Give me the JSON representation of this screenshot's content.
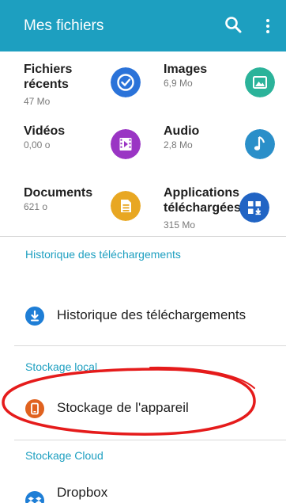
{
  "app_bar": {
    "title": "Mes fichiers",
    "icons": [
      "search-icon",
      "more-vert-icon"
    ],
    "color": "#1d9fc0"
  },
  "categories": [
    {
      "label": "Fichiers récents",
      "size": "47 Mo",
      "icon": "clock-check-icon",
      "color": "#2b73d9"
    },
    {
      "label": "Images",
      "size": "6,9 Mo",
      "icon": "image-icon",
      "color": "#2bb39a"
    },
    {
      "label": "Vidéos",
      "size": "0,00 o",
      "icon": "film-icon",
      "color": "#9a35c4"
    },
    {
      "label": "Audio",
      "size": "2,8 Mo",
      "icon": "music-note-icon",
      "color": "#2a8fc9"
    },
    {
      "label": "Documents",
      "size": "621 o",
      "icon": "document-icon",
      "color": "#e8a722"
    },
    {
      "label": "Applications téléchargées",
      "size": "315 Mo",
      "icon": "app-download-icon",
      "color": "#2164c4"
    }
  ],
  "sections": {
    "downloads": {
      "header": "Historique des téléchargements",
      "item": {
        "label": "Historique des téléchargements",
        "icon": "download-circle-icon",
        "color": "#1e7ed6"
      }
    },
    "local": {
      "header": "Stockage local",
      "item": {
        "label": "Stockage de l'appareil",
        "icon": "device-storage-icon",
        "color": "#e0621f"
      }
    },
    "cloud": {
      "header": "Stockage Cloud",
      "item": {
        "label": "Dropbox",
        "icon": "dropbox-icon",
        "color": "#1e7ed6"
      }
    }
  },
  "annotation_color": "#e51b1b"
}
